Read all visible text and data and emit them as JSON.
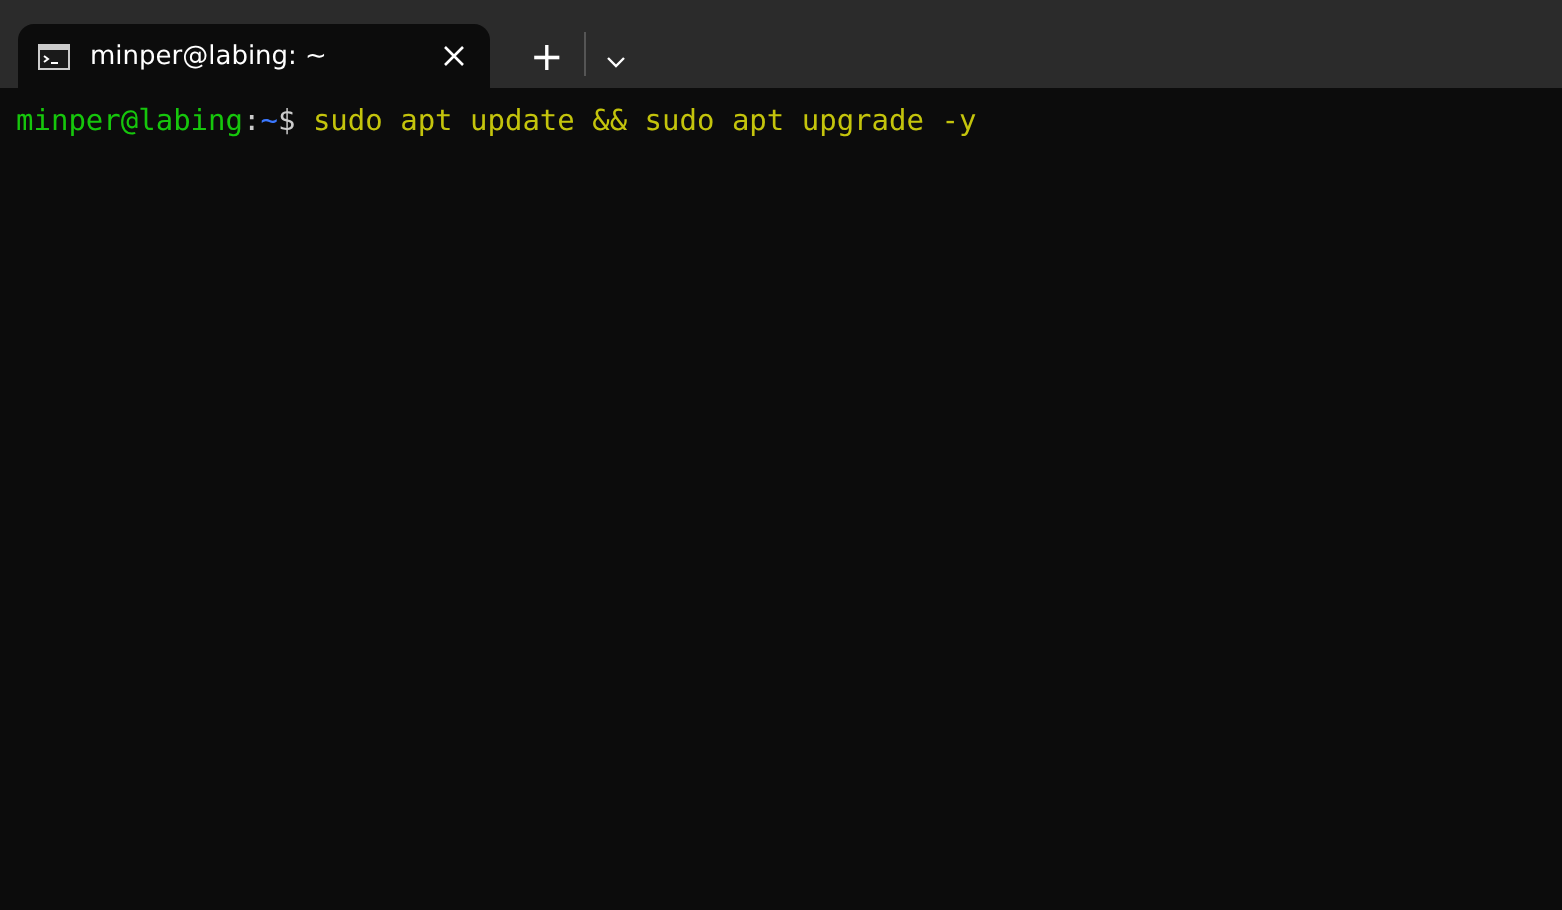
{
  "tabs": [
    {
      "title": "minper@labing: ~",
      "selected": true
    }
  ],
  "tab_bar": {
    "new_tab": "+"
  },
  "terminal": {
    "lines": [
      {
        "user_host": "minper@labing",
        "separator": ":",
        "path": "~",
        "symbol": "$",
        "command": "sudo apt update && sudo apt upgrade -y"
      }
    ]
  }
}
